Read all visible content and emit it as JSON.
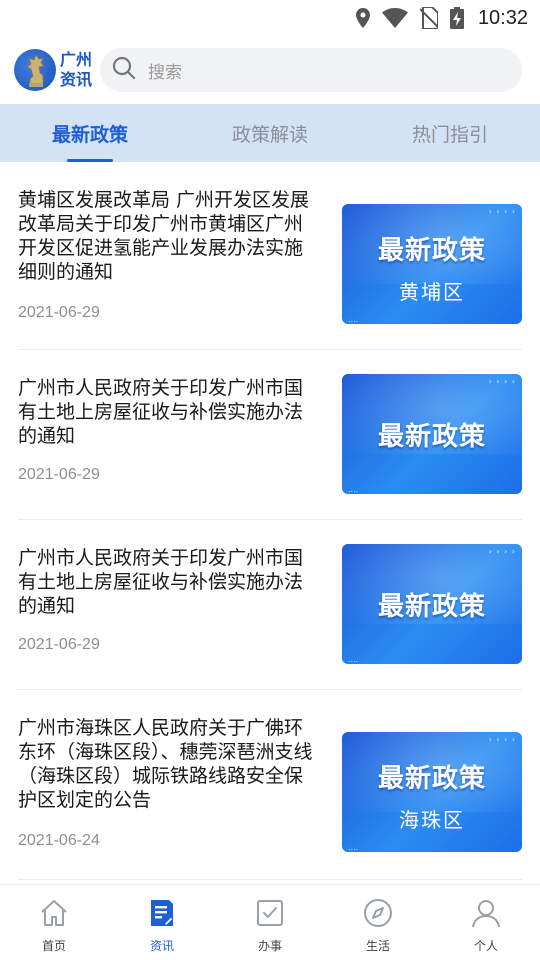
{
  "status_bar": {
    "time": "10:32"
  },
  "header": {
    "logo_line1": "广州",
    "logo_line2": "资讯",
    "search_placeholder": "搜索"
  },
  "tabs": [
    {
      "label": "最新政策",
      "active": true
    },
    {
      "label": "政策解读",
      "active": false
    },
    {
      "label": "热门指引",
      "active": false
    }
  ],
  "articles": [
    {
      "title": "黄埔区发展改革局 广州开发区发展改革局关于印发广州市黄埔区广州开发区促进氢能产业发展办法实施细则的通知",
      "date": "2021-06-29",
      "thumb_title": "最新政策",
      "thumb_sub": "黄埔区"
    },
    {
      "title": "广州市人民政府关于印发广州市国有土地上房屋征收与补偿实施办法的通知",
      "date": "2021-06-29",
      "thumb_title": "最新政策",
      "thumb_sub": ""
    },
    {
      "title": "广州市人民政府关于印发广州市国有土地上房屋征收与补偿实施办法的通知",
      "date": "2021-06-29",
      "thumb_title": "最新政策",
      "thumb_sub": ""
    },
    {
      "title": "广州市海珠区人民政府关于广佛环东环（海珠区段）、穗莞深琶洲支线（海珠区段）城际铁路线路安全保护区划定的公告",
      "date": "2021-06-24",
      "thumb_title": "最新政策",
      "thumb_sub": "海珠区"
    }
  ],
  "bottom_nav": [
    {
      "label": "首页",
      "icon": "home-icon",
      "active": false
    },
    {
      "label": "资讯",
      "icon": "news-icon",
      "active": true
    },
    {
      "label": "办事",
      "icon": "checkbox-icon",
      "active": false
    },
    {
      "label": "生活",
      "icon": "compass-icon",
      "active": false
    },
    {
      "label": "个人",
      "icon": "person-icon",
      "active": false
    }
  ],
  "colors": {
    "accent": "#1f5fd6",
    "tab_bar_bg": "#d4e2f6",
    "thumb_blue": "#1a57d8"
  }
}
